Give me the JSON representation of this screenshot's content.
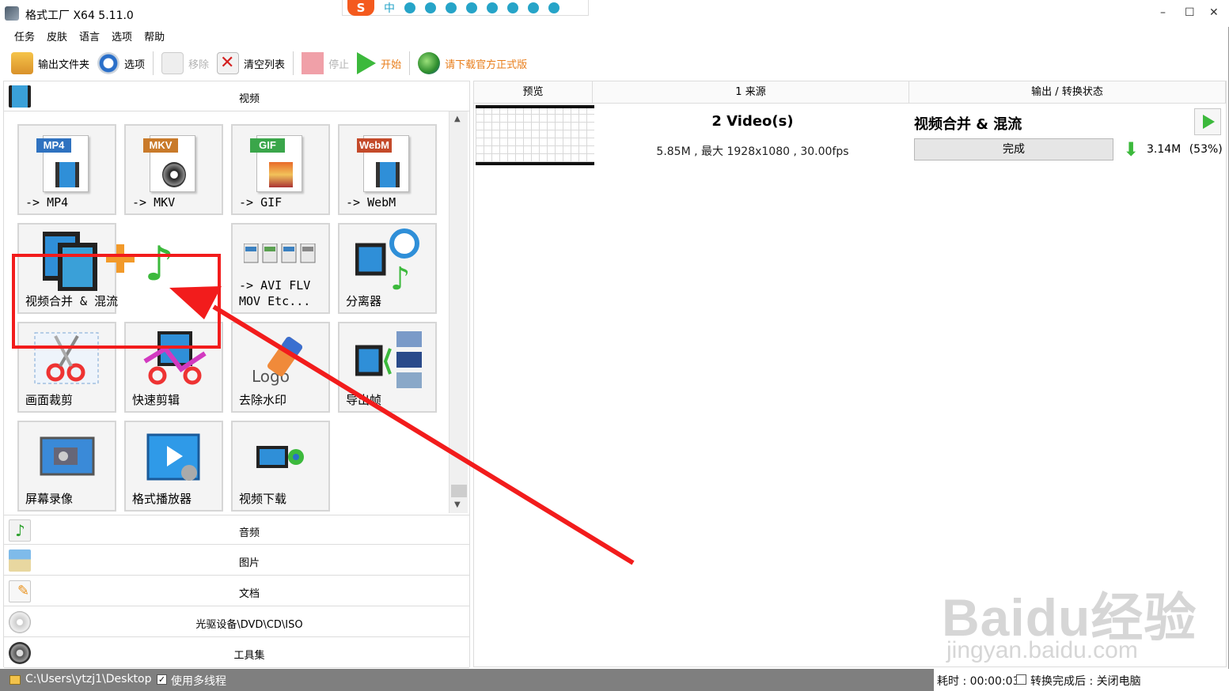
{
  "window": {
    "title": "格式工厂 X64 5.11.0",
    "minimize": "–",
    "maximize": "☐",
    "close": "✕"
  },
  "ime": {
    "badge": "S",
    "lang": "中"
  },
  "menu": [
    "任务",
    "皮肤",
    "语言",
    "选项",
    "帮助"
  ],
  "toolbar": {
    "output_folder": "输出文件夹",
    "options": "选项",
    "remove": "移除",
    "clear_list": "清空列表",
    "stop": "停止",
    "start": "开始",
    "download_official": "请下载官方正式版"
  },
  "left_panel": {
    "video_header": "视频",
    "tiles": [
      {
        "id": "mp4",
        "badge": "MP4",
        "label": "-> MP4"
      },
      {
        "id": "mkv",
        "badge": "MKV",
        "label": "-> MKV"
      },
      {
        "id": "gif",
        "badge": "GIF",
        "label": "-> GIF"
      },
      {
        "id": "webm",
        "badge": "WebM",
        "label": "-> WebM"
      },
      {
        "id": "merge",
        "label": "视频合并 & 混流"
      },
      {
        "id": "avi",
        "label": "-> AVI FLV\nMOV Etc..."
      },
      {
        "id": "splitter",
        "label": "分离器"
      },
      {
        "id": "crop",
        "label": "画面裁剪"
      },
      {
        "id": "quickcut",
        "label": "快速剪辑"
      },
      {
        "id": "logo",
        "art": "Logo",
        "label": "去除水印"
      },
      {
        "id": "frames",
        "label": "导出帧"
      },
      {
        "id": "screenrec",
        "label": "屏幕录像"
      },
      {
        "id": "player",
        "label": "格式播放器"
      },
      {
        "id": "download",
        "label": "视频下载"
      }
    ],
    "categories": [
      "音频",
      "图片",
      "文档",
      "光驱设备\\DVD\\CD\\ISO",
      "工具集"
    ]
  },
  "task_list": {
    "headers": [
      "预览",
      "1 来源",
      "输出 / 转换状态"
    ],
    "source_title": "2 Video(s)",
    "source_info": "5.85M , 最大 1928x1080 , 30.00fps",
    "output_title": "视频合并 & 混流",
    "status": "完成",
    "output_size": "3.14M",
    "output_ratio": "(53%)"
  },
  "status_bar": {
    "path": "C:\\Users\\ytzj1\\Desktop",
    "multithread": "使用多线程",
    "elapsed": "耗时 : 00:00:03",
    "after_done": "转换完成后 : 关闭电脑"
  },
  "watermark": {
    "logo": "Baidu经验",
    "url": "jingyan.baidu.com"
  },
  "colors": {
    "highlight": "#f21c1c",
    "start_green": "#3cb93c",
    "link_orange": "#e87d1a",
    "statusbar": "#7f7f7f"
  }
}
